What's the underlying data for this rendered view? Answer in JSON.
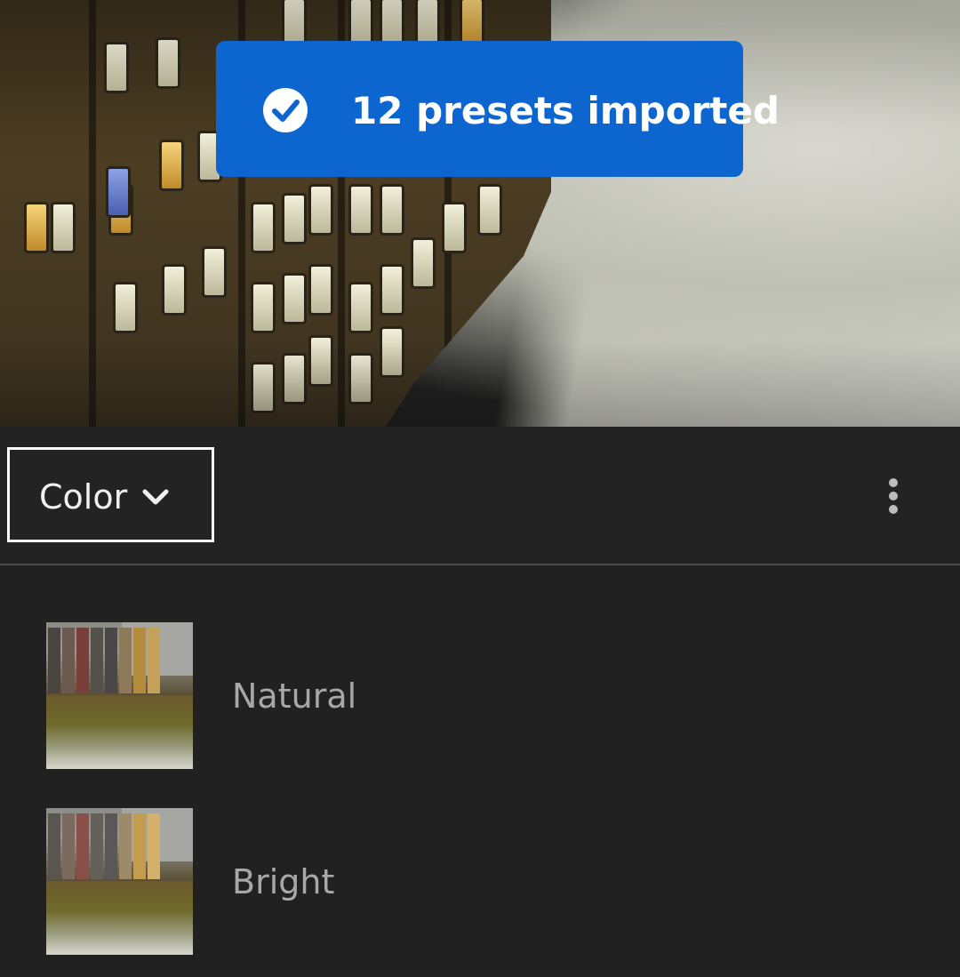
{
  "toast": {
    "message": "12 presets imported",
    "icon": "checkmark-circle-icon",
    "color": "#0d66d0"
  },
  "header": {
    "category": "Color",
    "dropdown_icon": "chevron-down-icon",
    "more_icon": "more-vertical-icon"
  },
  "presets": [
    {
      "name": "Natural"
    },
    {
      "name": "Bright"
    }
  ],
  "colors": {
    "panel_background": "#212121",
    "accent": "#0d66d0",
    "preset_text": "#a8a8a8"
  }
}
